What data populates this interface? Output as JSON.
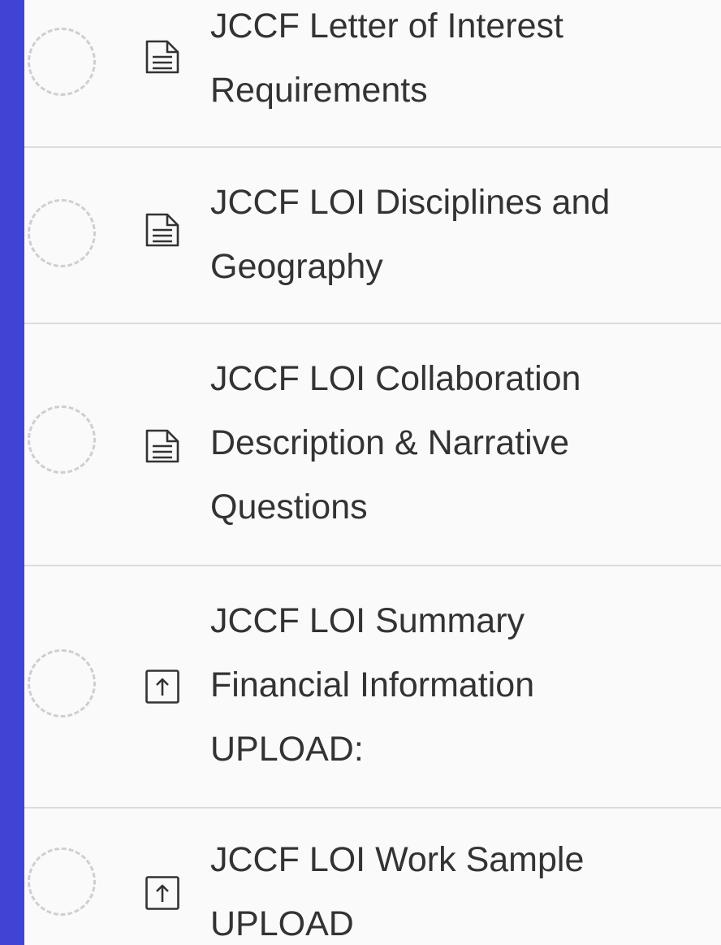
{
  "accent_color": "#3f44d4",
  "tasks": [
    {
      "label": "JCCF Letter of Interest\nRequirements",
      "icon": "document-icon"
    },
    {
      "label": "JCCF LOI Disciplines and\nGeography",
      "icon": "document-icon"
    },
    {
      "label": "JCCF LOI Collaboration\nDescription & Narrative\nQuestions",
      "icon": "document-icon"
    },
    {
      "label": "JCCF LOI Summary\nFinancial Information\nUPLOAD:",
      "icon": "upload-icon"
    },
    {
      "label": "JCCF LOI Work Sample\nUPLOAD",
      "icon": "upload-icon"
    }
  ]
}
